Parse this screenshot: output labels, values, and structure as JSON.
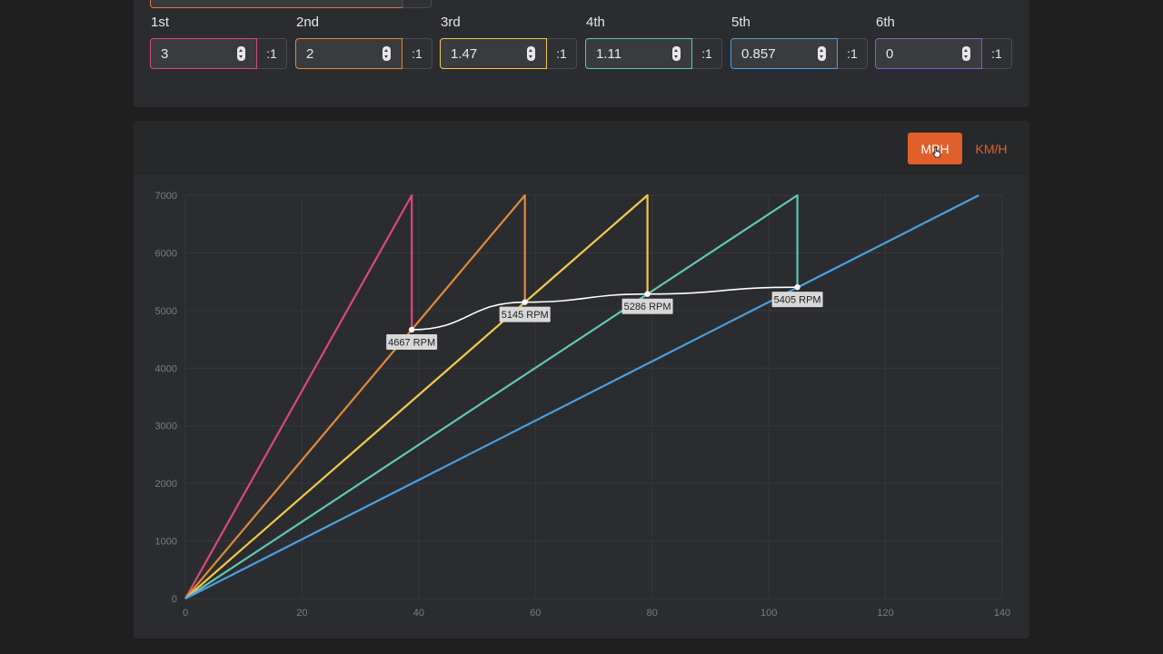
{
  "gears": [
    {
      "label": "1st",
      "value": "3",
      "unit": ":1",
      "color": "#d94a78"
    },
    {
      "label": "2nd",
      "value": "2",
      "unit": ":1",
      "color": "#e08a3c"
    },
    {
      "label": "3rd",
      "value": "1.47",
      "unit": ":1",
      "color": "#f2c94c"
    },
    {
      "label": "4th",
      "value": "1.11",
      "unit": ":1",
      "color": "#5ec8b5"
    },
    {
      "label": "5th",
      "value": "0.857",
      "unit": ":1",
      "color": "#4a9fe0"
    },
    {
      "label": "6th",
      "value": "0",
      "unit": ":1",
      "color": "#8a5ac8"
    }
  ],
  "units": {
    "mph_label": "MPH",
    "kmh_label": "KM/H",
    "active": "MPH",
    "accent": "#e0602c"
  },
  "chart_data": {
    "type": "line",
    "xlim": [
      0,
      140
    ],
    "ylim": [
      0,
      7000
    ],
    "x_ticks": [
      0,
      20,
      40,
      60,
      80,
      100,
      120,
      140
    ],
    "y_ticks": [
      0,
      1000,
      2000,
      3000,
      4000,
      5000,
      6000,
      7000
    ],
    "grid": true,
    "series": [
      {
        "color": "#d94a78",
        "points": [
          [
            0,
            0
          ],
          [
            38.8,
            7000
          ],
          [
            38.8,
            4667
          ]
        ]
      },
      {
        "color": "#e08a3c",
        "points": [
          [
            0,
            0
          ],
          [
            58.2,
            7000
          ],
          [
            58.2,
            5145
          ]
        ]
      },
      {
        "color": "#f2c94c",
        "points": [
          [
            0,
            0
          ],
          [
            79.2,
            7000
          ],
          [
            79.2,
            5286
          ]
        ]
      },
      {
        "color": "#5ec8b5",
        "points": [
          [
            0,
            0
          ],
          [
            104.9,
            7000
          ],
          [
            104.9,
            5405
          ]
        ]
      },
      {
        "color": "#4a9fe0",
        "points": [
          [
            0,
            0
          ],
          [
            136,
            7000
          ]
        ]
      }
    ],
    "shift_points": [
      {
        "x": 38.8,
        "y": 4667,
        "label": "4667 RPM"
      },
      {
        "x": 58.2,
        "y": 5145,
        "label": "5145 RPM"
      },
      {
        "x": 79.2,
        "y": 5286,
        "label": "5286 RPM"
      },
      {
        "x": 104.9,
        "y": 5405,
        "label": "5405 RPM"
      }
    ],
    "shift_curve_color": "#ffffff"
  }
}
